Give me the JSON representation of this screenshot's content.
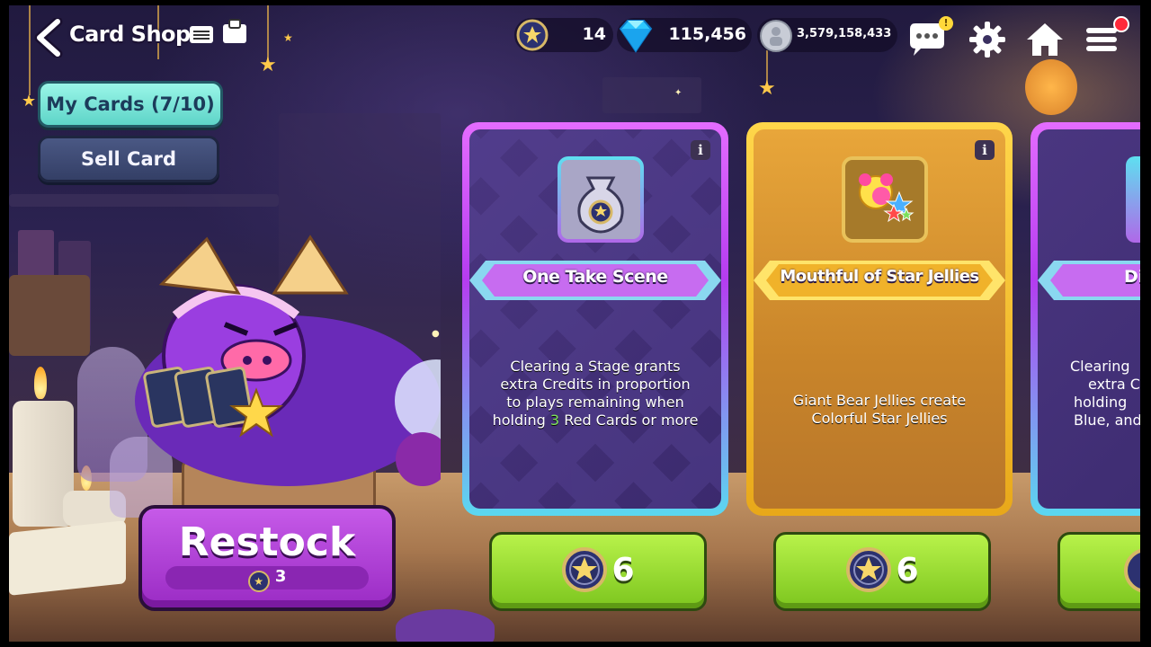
{
  "header": {
    "back_label": "back",
    "title": "Card Shop"
  },
  "resources": {
    "coins": "14",
    "gems": "115,456",
    "silver": "3,579,158,433",
    "chat_badge": "!"
  },
  "left_menu": {
    "my_cards_label": "My Cards (7/10)",
    "sell_card_label": "Sell Card"
  },
  "restock": {
    "label": "Restock",
    "cost": "3"
  },
  "cards": [
    {
      "name": "One Take Scene",
      "description_parts": [
        "Clearing a Stage grants extra Credits in proportion to plays remaining when holding ",
        "3",
        " Red Cards or more"
      ],
      "price": "6",
      "info": "i"
    },
    {
      "name": "Mouthful of Star Jellies",
      "description": "Giant Bear Jellies create Colorful Star Jellies",
      "price": "6",
      "info": "i"
    },
    {
      "name": "Di",
      "description_lines": [
        "Clearing",
        "extra C",
        "holding",
        "Blue, and"
      ]
    }
  ],
  "colors": {
    "purple_card": "#b53cf0",
    "gold_card": "#f2b51e",
    "buy_green": "#8fd526",
    "highlight_number": "#7fe35a"
  }
}
